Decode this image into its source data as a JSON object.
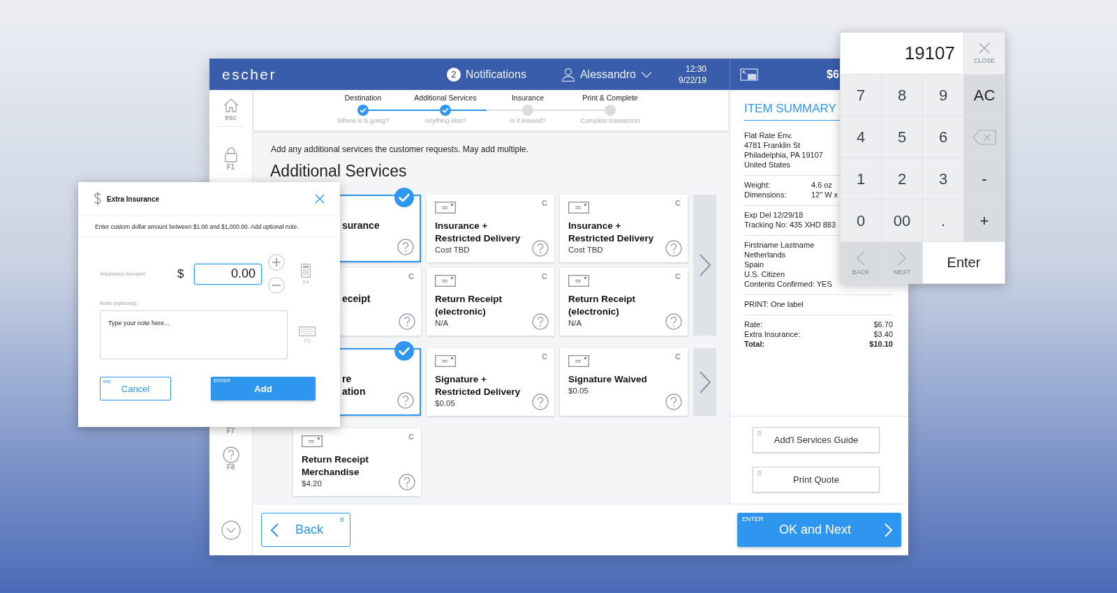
{
  "app": {
    "header": {
      "logo": "escher",
      "notifications": {
        "count": "2",
        "label": "Notifications"
      },
      "user": "Alessandro",
      "time": "12:30",
      "date": "9/22/19",
      "balance": "$6"
    },
    "sidebar": [
      {
        "kind": "home",
        "label": "esc"
      },
      {
        "kind": "lock",
        "label": "F1"
      },
      {
        "kind": "none",
        "label": "F7"
      },
      {
        "kind": "help",
        "label": "F8"
      }
    ],
    "steps": [
      {
        "label": "Destination",
        "hint": "Where is is going?",
        "done": true
      },
      {
        "label": "Additional Services",
        "hint": "Anything else?",
        "done": true
      },
      {
        "label": "Insurance",
        "hint": "Is it insured?",
        "done": false
      },
      {
        "label": "Print & Complete",
        "hint": "Complete transaction",
        "done": false
      }
    ],
    "instruction": "Add any additional services the customer requests. May add multiple.",
    "heading": "Additional Services",
    "card_groups": [
      {
        "has_next": true,
        "cards": [
          {
            "covered": true,
            "title_lines": [
              "surance"
            ],
            "selected": true
          },
          {
            "covered": false,
            "tag": "C",
            "title_lines": [
              "Insurance +",
              "Restricted Delivery"
            ],
            "price": "Cost TBD",
            "selected": false
          },
          {
            "covered": false,
            "tag": "C",
            "title_lines": [
              "Insurance +",
              "Restricted Delivery"
            ],
            "price": "Cost TBD",
            "selected": false
          },
          {
            "covered": true,
            "tag": "C",
            "title_lines": [
              "eceipt"
            ],
            "selected": false
          },
          {
            "covered": false,
            "tag": "C",
            "title_lines": [
              "Return Receipt",
              "(electronic)"
            ],
            "price": "N/A",
            "selected": false
          },
          {
            "covered": false,
            "tag": "C",
            "title_lines": [
              "Return Receipt",
              "(electronic)"
            ],
            "price": "N/A",
            "selected": false
          }
        ]
      },
      {
        "has_next": true,
        "cards": [
          {
            "covered": true,
            "title_lines": [
              "re",
              "ation"
            ],
            "selected": true
          },
          {
            "covered": false,
            "tag": "C",
            "title_lines": [
              "Signature +",
              "Restricted Delivery"
            ],
            "price": "$0.05",
            "selected": false
          },
          {
            "covered": false,
            "tag": "C",
            "title_lines": [
              "Signature Waived"
            ],
            "price": "$0.05",
            "selected": false
          }
        ]
      },
      {
        "has_next": false,
        "cards": [
          {
            "covered": false,
            "tag": "C",
            "title_lines": [
              "Return Receipt",
              "Merchandise"
            ],
            "price": "$4.20",
            "selected": false
          }
        ]
      }
    ],
    "summary": {
      "title": "ITEM SUMMARY",
      "sections": [
        {
          "kind": "lines",
          "lines": [
            "Flat Rate Env.",
            "4781 Franklin St",
            "Philadelphia, PA 19107",
            "United States"
          ]
        },
        {
          "kind": "pairs",
          "rows": [
            {
              "label": "Weight:",
              "value": "4.6 oz",
              "bold": false
            },
            {
              "label": "Dimensions:",
              "value": "12″ W x",
              "bold": false
            }
          ]
        },
        {
          "kind": "lines",
          "lines": [
            "Exp Del 12/29/18",
            "Tracking No: 435 XHD 883"
          ]
        },
        {
          "kind": "lines",
          "lines": [
            "Firstname Lastname",
            "Netherlands",
            "Spain",
            "U.S. Citizen",
            "Contents Confirmed: YES"
          ]
        },
        {
          "kind": "lines",
          "lines": [
            "PRINT: One label"
          ]
        },
        {
          "kind": "totals",
          "rows": [
            {
              "label": "Rate:",
              "value": "$6.70",
              "bold": false
            },
            {
              "label": "Extra Insurance:",
              "value": "$3.40",
              "bold": false
            },
            {
              "label": "Total:",
              "value": "$10.10",
              "bold": true
            }
          ]
        }
      ]
    },
    "side_buttons": [
      {
        "key": "B",
        "label": "Add'l Services Guide"
      },
      {
        "key": "B",
        "label": "Print Quote"
      }
    ],
    "back": {
      "key": "B",
      "label": "Back"
    },
    "next": {
      "key": "ENTER",
      "label": "OK and Next"
    }
  },
  "modal": {
    "title": "Extra Insurance",
    "instruction": "Enter custom dollar amount between $1.00 and $1,000.00. Add optional note.",
    "amount_label": "Insurance Amount:",
    "currency": "$",
    "amount": "0.00",
    "calc_key": "F4",
    "note_label": "Note (optional):",
    "note_placeholder": "Type your note here...",
    "keyboard_key": "F3",
    "cancel": {
      "key": "esc",
      "label": "Cancel"
    },
    "add": {
      "key": "ENTER",
      "label": "Add"
    }
  },
  "keypad": {
    "display": "19107",
    "close": "CLOSE",
    "keys": [
      {
        "kind": "digit",
        "label": "7"
      },
      {
        "kind": "digit",
        "label": "8"
      },
      {
        "kind": "digit",
        "label": "9"
      },
      {
        "kind": "op",
        "label": "AC"
      },
      {
        "kind": "digit",
        "label": "4"
      },
      {
        "kind": "digit",
        "label": "5"
      },
      {
        "kind": "digit",
        "label": "6"
      },
      {
        "kind": "backspace"
      },
      {
        "kind": "digit",
        "label": "1"
      },
      {
        "kind": "digit",
        "label": "2"
      },
      {
        "kind": "digit",
        "label": "3"
      },
      {
        "kind": "op",
        "label": "-"
      },
      {
        "kind": "digit",
        "label": "0"
      },
      {
        "kind": "digit",
        "label": "00"
      },
      {
        "kind": "digit",
        "label": "."
      },
      {
        "kind": "op",
        "label": "+"
      },
      {
        "kind": "prev",
        "label": "BACK"
      },
      {
        "kind": "next",
        "label": "NEXT"
      },
      {
        "kind": "enter",
        "label": "Enter"
      }
    ]
  }
}
